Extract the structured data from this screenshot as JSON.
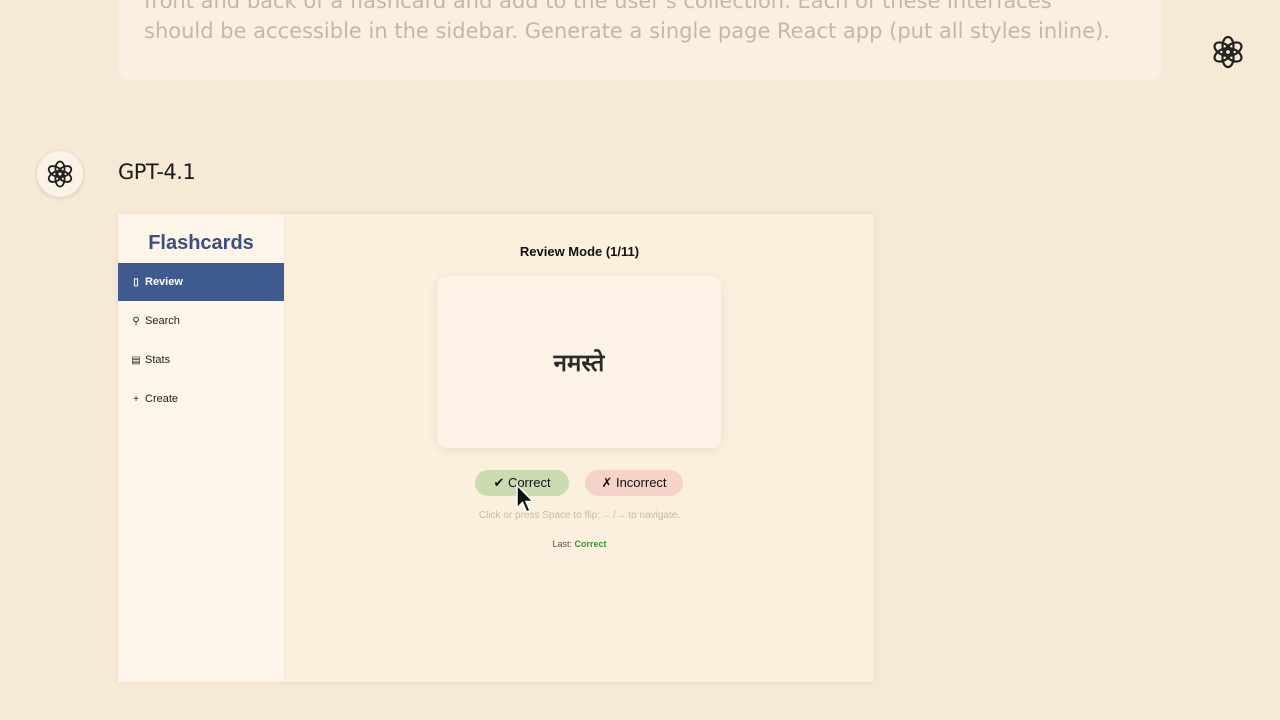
{
  "prompt": {
    "line1": "front and back of a flashcard and add to the user's collection. Each of these interfaces",
    "line2": "should be accessible in the sidebar. Generate a single page React app (put all styles inline)."
  },
  "model": {
    "name": "GPT-4.1"
  },
  "icons": {
    "brand": "openai-logo-icon",
    "cursor": "mouse-pointer-icon"
  },
  "colors": {
    "sidebar_active": "#3e5a8e",
    "correct_button": "#c8dcb0",
    "incorrect_button": "#f6d3c8",
    "last_status": "#2e9a3a"
  },
  "app": {
    "sidebar": {
      "title": "Flashcards",
      "items": [
        {
          "icon": "▯",
          "icon_name": "phone-icon",
          "label": "Review",
          "active": true
        },
        {
          "icon": "⚲",
          "icon_name": "magnifier-icon",
          "label": "Search",
          "active": false
        },
        {
          "icon": "▤",
          "icon_name": "chart-icon",
          "label": "Stats",
          "active": false
        },
        {
          "icon": "+",
          "icon_name": "plus-icon",
          "label": "Create",
          "active": false
        }
      ]
    },
    "review": {
      "title": "Review Mode (1/11)",
      "card_front": "नमस्ते",
      "correct_label": "✔ Correct",
      "incorrect_label": "✗ Incorrect",
      "hint": "Click or press Space to flip; ←/→ to navigate.",
      "last_label": "Last: ",
      "last_value": "Correct"
    }
  }
}
